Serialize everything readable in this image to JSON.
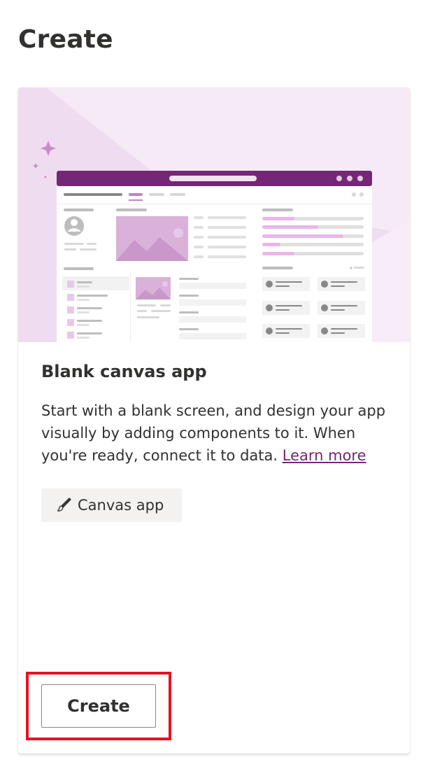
{
  "page": {
    "title": "Create"
  },
  "card": {
    "title": "Blank canvas app",
    "description": "Start with a blank screen, and design your app visually by adding components to it. When you're ready, connect it to data.",
    "learn_more": "Learn more",
    "tag_label": "Canvas app",
    "tag_icon": "brush-icon",
    "create_label": "Create"
  },
  "colors": {
    "accent": "#742774",
    "illustration_bg": "#f4e6f4",
    "illustration_soft": "#e8c8e8",
    "highlight": "#e81123"
  }
}
